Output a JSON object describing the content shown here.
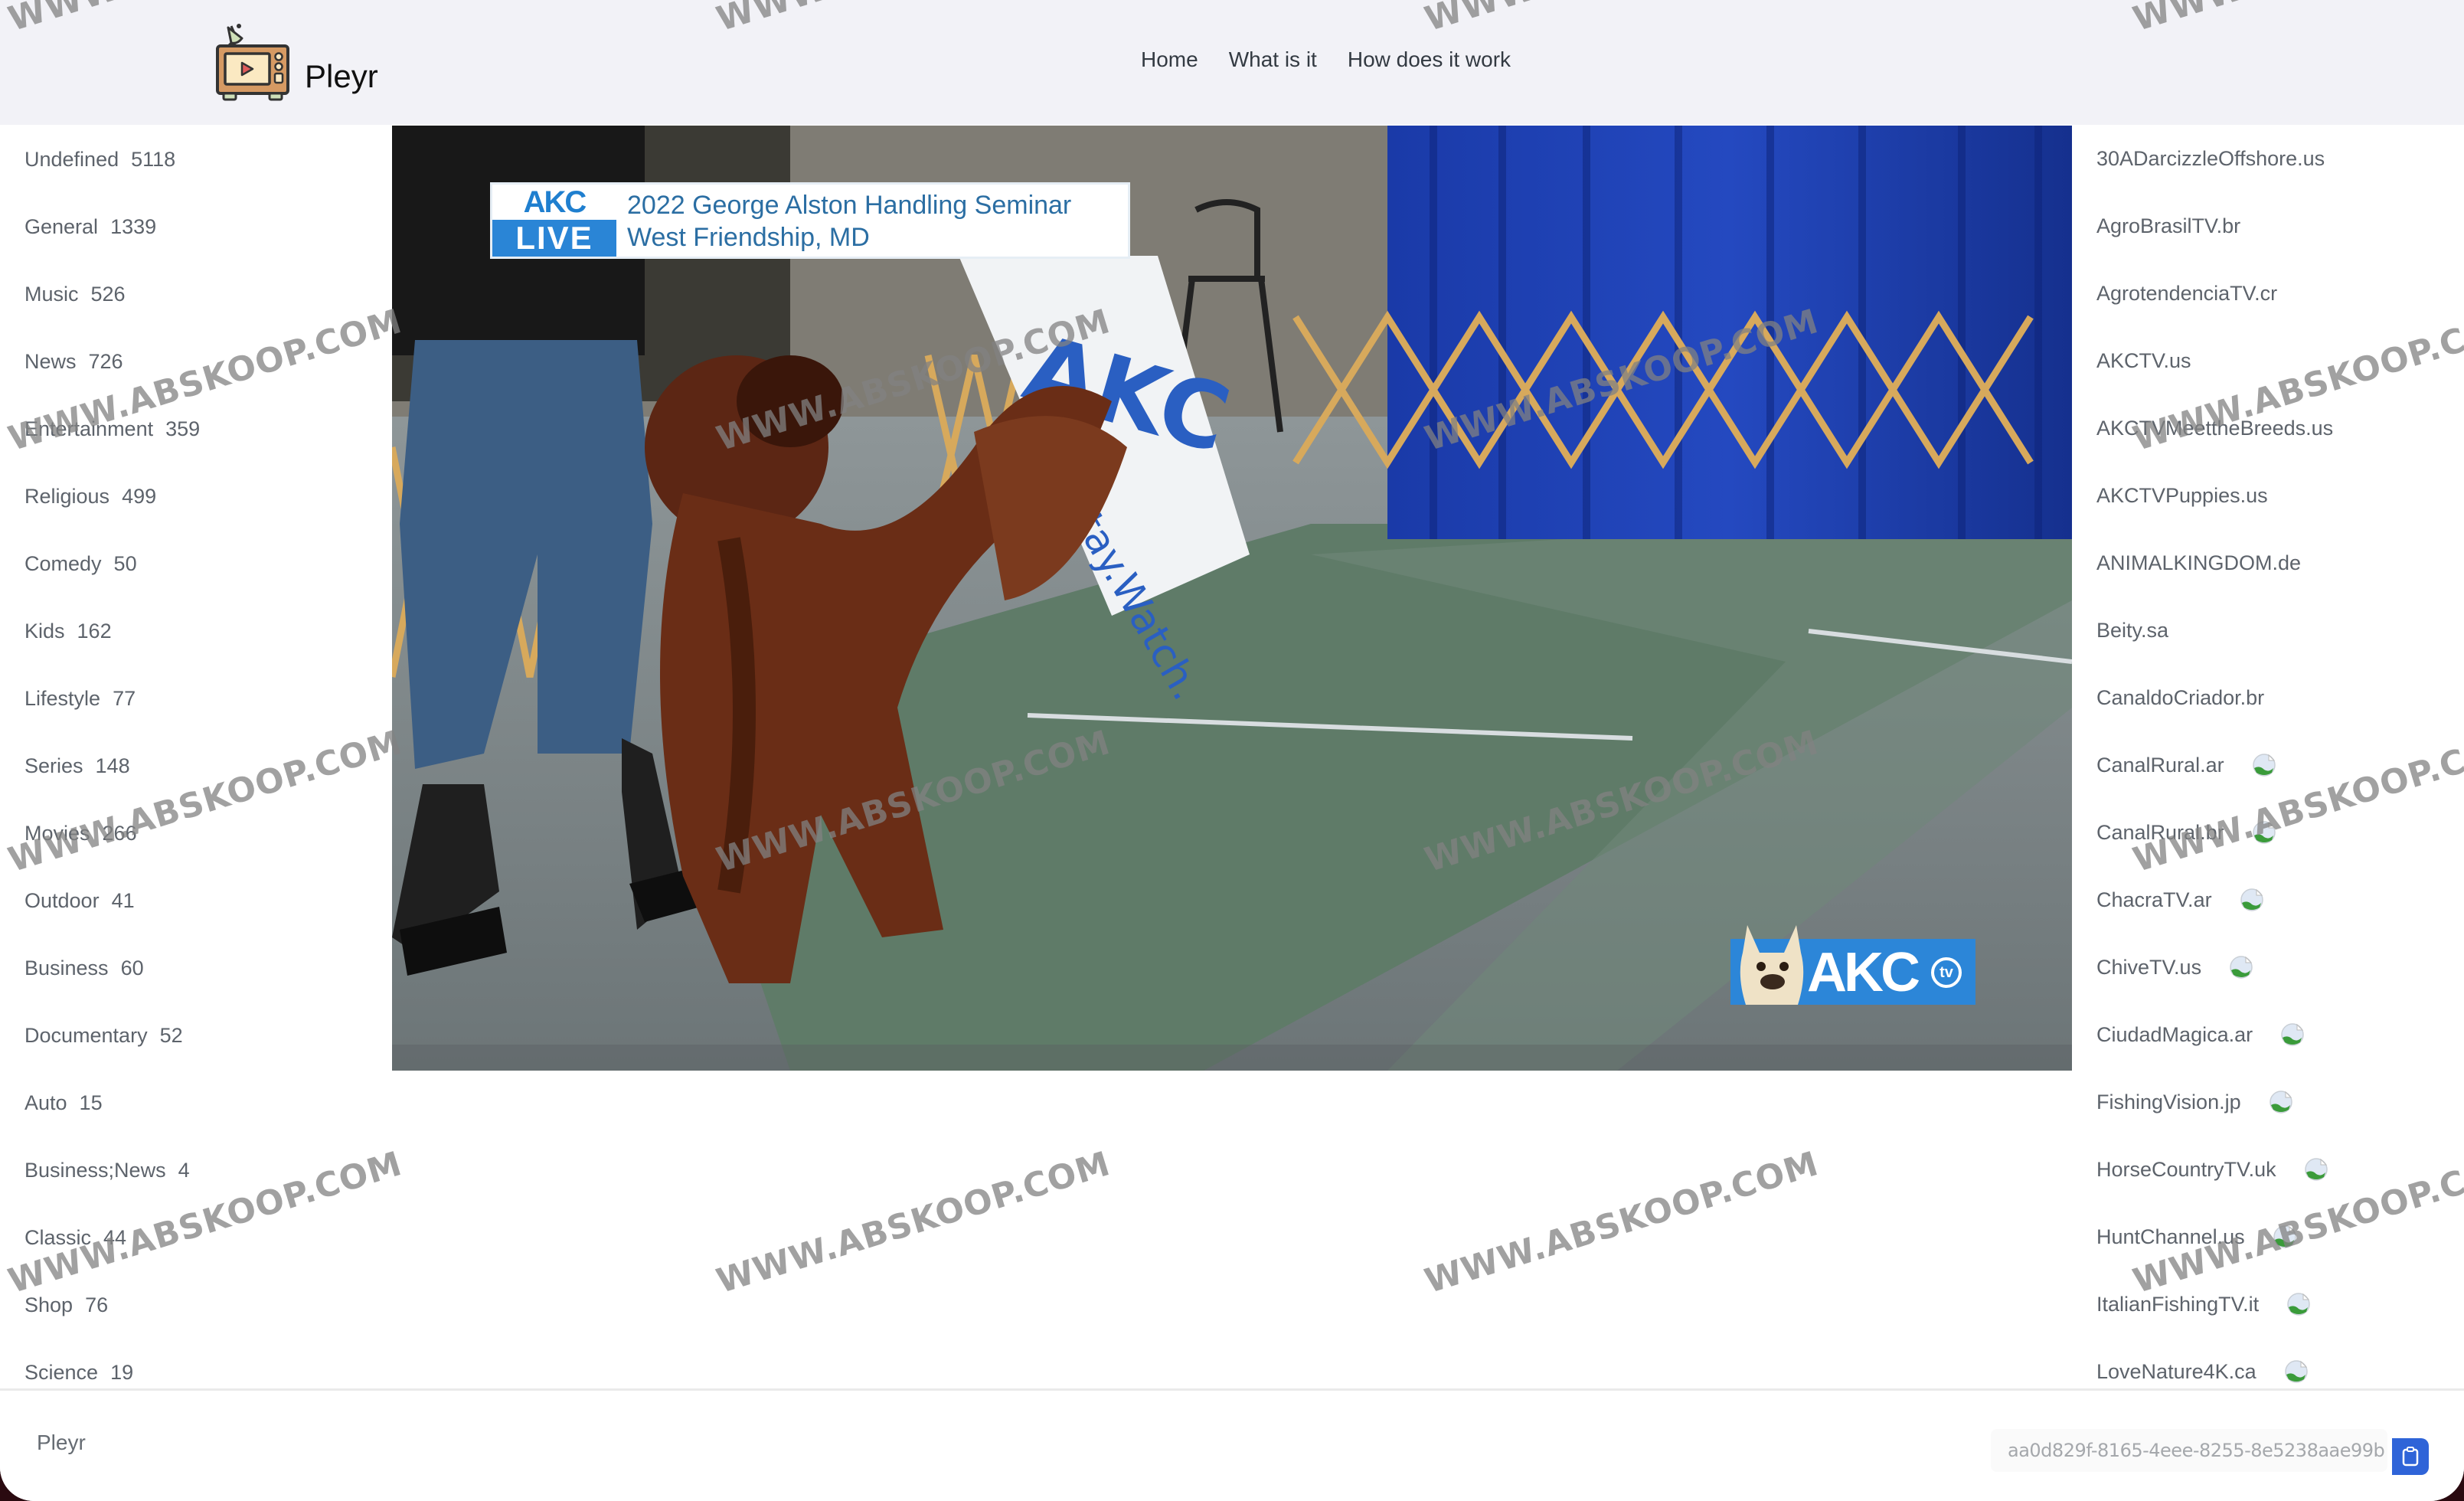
{
  "header": {
    "brand_name": "Pleyr",
    "logo_icon": "retro-tv-logo-icon",
    "nav": [
      {
        "label": "Home"
      },
      {
        "label": "What is it"
      },
      {
        "label": "How does it work"
      }
    ]
  },
  "categories": [
    {
      "name": "Undefined",
      "count": "5118"
    },
    {
      "name": "General",
      "count": "1339"
    },
    {
      "name": "Music",
      "count": "526"
    },
    {
      "name": "News",
      "count": "726"
    },
    {
      "name": "Entertainment",
      "count": "359"
    },
    {
      "name": "Religious",
      "count": "499"
    },
    {
      "name": "Comedy",
      "count": "50"
    },
    {
      "name": "Kids",
      "count": "162"
    },
    {
      "name": "Lifestyle",
      "count": "77"
    },
    {
      "name": "Series",
      "count": "148"
    },
    {
      "name": "Movies",
      "count": "266"
    },
    {
      "name": "Outdoor",
      "count": "41"
    },
    {
      "name": "Business",
      "count": "60"
    },
    {
      "name": "Documentary",
      "count": "52"
    },
    {
      "name": "Auto",
      "count": "15"
    },
    {
      "name": "Business;News",
      "count": "4"
    },
    {
      "name": "Classic",
      "count": "44"
    },
    {
      "name": "Shop",
      "count": "76"
    },
    {
      "name": "Science",
      "count": "19"
    }
  ],
  "video": {
    "lower_third": {
      "badge_top": "AKC",
      "badge_bottom": "LIVE",
      "line1": "2022 George Alston Handling Seminar",
      "line2": "West Friendship, MD"
    },
    "bug": {
      "text": "AKC",
      "tv": "tv"
    },
    "sign_text": "AKC",
    "sign_tagline": "...Stay.Watch."
  },
  "channels": [
    {
      "name": "30ADarcizzleOffshore.us",
      "logo": false
    },
    {
      "name": "AgroBrasilTV.br",
      "logo": false
    },
    {
      "name": "AgrotendenciaTV.cr",
      "logo": false
    },
    {
      "name": "AKCTV.us",
      "logo": false
    },
    {
      "name": "AKCTVMeettheBreeds.us",
      "logo": false
    },
    {
      "name": "AKCTVPuppies.us",
      "logo": false
    },
    {
      "name": "ANIMALKINGDOM.de",
      "logo": false
    },
    {
      "name": "Beity.sa",
      "logo": false
    },
    {
      "name": "CanaldoCriador.br",
      "logo": false
    },
    {
      "name": "CanalRural.ar",
      "logo": true
    },
    {
      "name": "CanalRural.br",
      "logo": true
    },
    {
      "name": "ChacraTV.ar",
      "logo": true
    },
    {
      "name": "ChiveTV.us",
      "logo": true
    },
    {
      "name": "CiudadMagica.ar",
      "logo": true
    },
    {
      "name": "FishingVision.jp",
      "logo": true
    },
    {
      "name": "HorseCountryTV.uk",
      "logo": true
    },
    {
      "name": "HuntChannel.us",
      "logo": true
    },
    {
      "name": "ItalianFishingTV.it",
      "logo": true
    },
    {
      "name": "LoveNature4K.ca",
      "logo": true
    }
  ],
  "footer": {
    "brand": "Pleyr",
    "uuid": "aa0d829f-8165-4eee-8255-8e5238aae99b",
    "copy_icon": "clipboard-icon"
  },
  "watermark": "WWW.ABSKOOP.COM",
  "colors": {
    "header_bg": "#f2f2f7",
    "accent": "#2f64d8",
    "text": "#5d636b"
  }
}
